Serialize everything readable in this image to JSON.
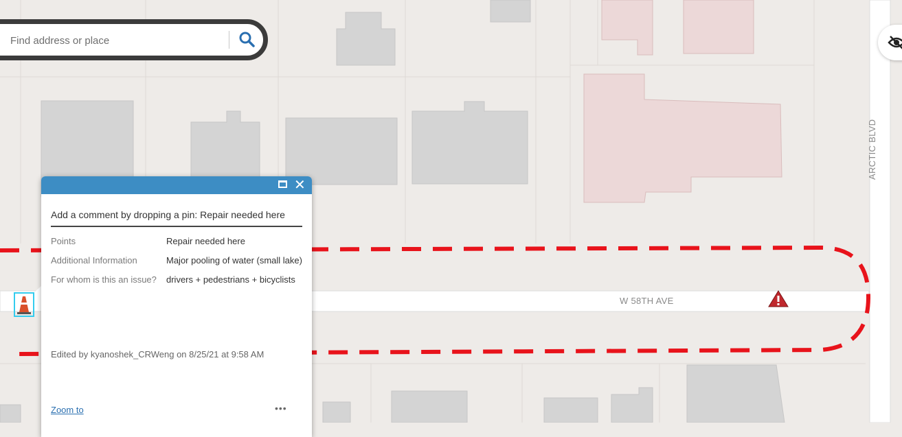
{
  "search": {
    "placeholder": "Find address or place"
  },
  "map": {
    "street_horizontal": "W 58TH AVE",
    "street_vertical": "ARCTIC BLVD",
    "colors": {
      "route": "#e8131b",
      "building": "#d4d4d4",
      "highlight_building": "#ecd8d8",
      "hazard": "#c0282d",
      "pin_highlight": "#33ccee"
    }
  },
  "controls": {
    "visibility_icon": "eye-off-icon"
  },
  "popup": {
    "title": "Add a comment by dropping a pin: Repair needed here",
    "fields": [
      {
        "label": "Points",
        "value": "Repair needed here"
      },
      {
        "label": "Additional Information",
        "value": "Major pooling of water (small lake)"
      },
      {
        "label": "For whom is this an issue?",
        "value": "drivers + pedestrians + bicyclists"
      }
    ],
    "edited": "Edited by kyanoshek_CRWeng on 8/25/21 at 9:58 AM",
    "zoom_link": "Zoom to",
    "more": "•••"
  }
}
